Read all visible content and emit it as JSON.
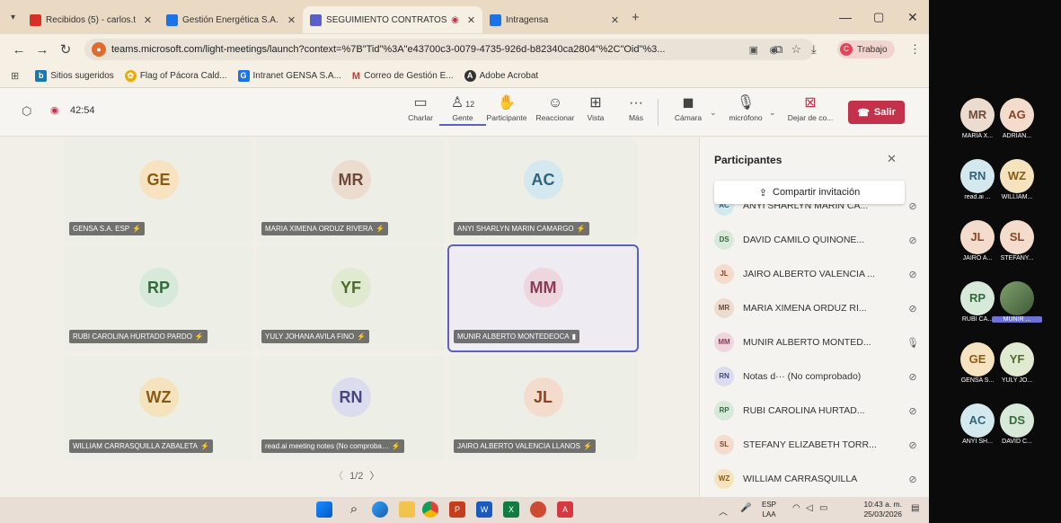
{
  "browser": {
    "tabs": [
      {
        "label": "Recibidos (5) - carlos.triana@g…",
        "icon": "gmail-icon",
        "color": "#d93025"
      },
      {
        "label": "Gestión Energética S.A. E.S.P - (…",
        "icon": "gensa-icon",
        "color": "#1a73e8"
      },
      {
        "label": "SEGUIMIENTO CONTRATOS",
        "icon": "teams-icon",
        "color": "#5b5fc7"
      },
      {
        "label": "Intragensa",
        "icon": "intragensa-icon",
        "color": "#1a73e8"
      }
    ],
    "url": "teams.microsoft.com/light-meetings/launch?context=%7B\"Tid\"%3A\"e43700c3-0079-4735-926d-b82340ca2804\"%2C\"Oid\"%3...",
    "profile": "Trabajo",
    "bookmarks": [
      "Sitios sugeridos",
      "Flag of Pácora Cald...",
      "Intranet GENSA S.A...",
      "Correo de Gestión E...",
      "Adobe Acrobat"
    ]
  },
  "meeting": {
    "timer": "42:54",
    "people_count": "12",
    "tools": [
      "Charlar",
      "Gente",
      "Participante",
      "Reaccionar",
      "Vista",
      "Más",
      "Cámara",
      "micrófono",
      "Dejar de co..."
    ],
    "leave_label": "Salir",
    "pager": "1/2",
    "tiles": [
      {
        "initials": "GE",
        "name": "GENSA S.A. ESP",
        "bg": "#f7e3bf",
        "fg": "#8a5a14"
      },
      {
        "initials": "MR",
        "name": "MARIA XIMENA ORDUZ RIVERA",
        "bg": "#ecdccf",
        "fg": "#6d4a39"
      },
      {
        "initials": "AC",
        "name": "ANYI SHARLYN MARIN CAMARGO",
        "bg": "#d4e8ef",
        "fg": "#2d6479"
      },
      {
        "initials": "RP",
        "name": "RUBI CAROLINA HURTADO PARDO",
        "bg": "#d7ead9",
        "fg": "#326b3b"
      },
      {
        "initials": "YF",
        "name": "YULY JOHANA AVILA FINO",
        "bg": "#dfead1",
        "fg": "#4d6b2a"
      },
      {
        "initials": "MM",
        "name": "MUNIR ALBERTO MONTEDEOCA",
        "bg": "#eed6df",
        "fg": "#8a3a57"
      },
      {
        "initials": "WZ",
        "name": "WILLIAM CARRASQUILLA ZABALETA",
        "bg": "#f5e3bd",
        "fg": "#8a5a14"
      },
      {
        "initials": "RN",
        "name": "read.ai meeting notes (No comproba…",
        "bg": "#dcdcef",
        "fg": "#464780"
      },
      {
        "initials": "JL",
        "name": "JAIRO ALBERTO VALENCIA LLANOS",
        "bg": "#f4dccd",
        "fg": "#8a4524"
      }
    ]
  },
  "panel": {
    "title": "Participantes",
    "share_label": "Compartir invitación",
    "people": [
      {
        "initials": "AC",
        "name": "ANYI SHARLYN MARIN CA...",
        "bg": "#d4e8ef",
        "fg": "#2d6479"
      },
      {
        "initials": "DS",
        "name": "DAVID CAMILO QUINONE...",
        "bg": "#d7ead9",
        "fg": "#326b3b"
      },
      {
        "initials": "JL",
        "name": "JAIRO ALBERTO VALENCIA ...",
        "bg": "#f4dccd",
        "fg": "#8a4524"
      },
      {
        "initials": "MR",
        "name": "MARIA XIMENA ORDUZ RI...",
        "bg": "#ecdccf",
        "fg": "#6d4a39"
      },
      {
        "initials": "MM",
        "name": "MUNIR ALBERTO MONTED...",
        "bg": "#eed6df",
        "fg": "#8a3a57"
      },
      {
        "initials": "RN",
        "name": "Notas d··· (No comprobado)",
        "bg": "#dcdcef",
        "fg": "#464780"
      },
      {
        "initials": "RP",
        "name": "RUBI CAROLINA HURTAD...",
        "bg": "#d7ead9",
        "fg": "#326b3b"
      },
      {
        "initials": "SL",
        "name": "STEFANY ELIZABETH TORR...",
        "bg": "#f4dccd",
        "fg": "#8a4524"
      },
      {
        "initials": "WZ",
        "name": "WILLIAM CARRASQUILLA",
        "bg": "#f5e3bd",
        "fg": "#8a5a14"
      }
    ]
  },
  "gallery": [
    {
      "initials": "MR",
      "name": "MARIA X...",
      "bg": "#ecdccf",
      "fg": "#6d4a39"
    },
    {
      "initials": "AG",
      "name": "ADRIAN...",
      "bg": "#f4dccd",
      "fg": "#8a4524"
    },
    {
      "initials": "RN",
      "name": "read.ai ...",
      "bg": "#d4e8ef",
      "fg": "#2d6479"
    },
    {
      "initials": "WZ",
      "name": "WILLIAM...",
      "bg": "#f5e3bd",
      "fg": "#8a5a14"
    },
    {
      "initials": "JL",
      "name": "JAIRO A...",
      "bg": "#f4dccd",
      "fg": "#8a4524"
    },
    {
      "initials": "SL",
      "name": "STEFANY...",
      "bg": "#f4dccd",
      "fg": "#8a4524"
    },
    {
      "initials": "RP",
      "name": "RUBI CA...",
      "bg": "#d7ead9",
      "fg": "#326b3b"
    },
    {
      "initials": "",
      "name": "MUNIR ...",
      "bg": "#6e8a5e",
      "fg": "#ffffff"
    },
    {
      "initials": "GE",
      "name": "GENSA S...",
      "bg": "#f7e3bf",
      "fg": "#8a5a14"
    },
    {
      "initials": "YF",
      "name": "YULY JO...",
      "bg": "#dfead1",
      "fg": "#4d6b2a"
    },
    {
      "initials": "AC",
      "name": "ANYI SH...",
      "bg": "#d4e8ef",
      "fg": "#2d6479"
    },
    {
      "initials": "DS",
      "name": "DAVID C...",
      "bg": "#d7ead9",
      "fg": "#326b3b"
    }
  ],
  "system": {
    "lang": "ESP",
    "layout": "LAA",
    "time": "10:43 a. m.",
    "date": "25/03/2026"
  }
}
